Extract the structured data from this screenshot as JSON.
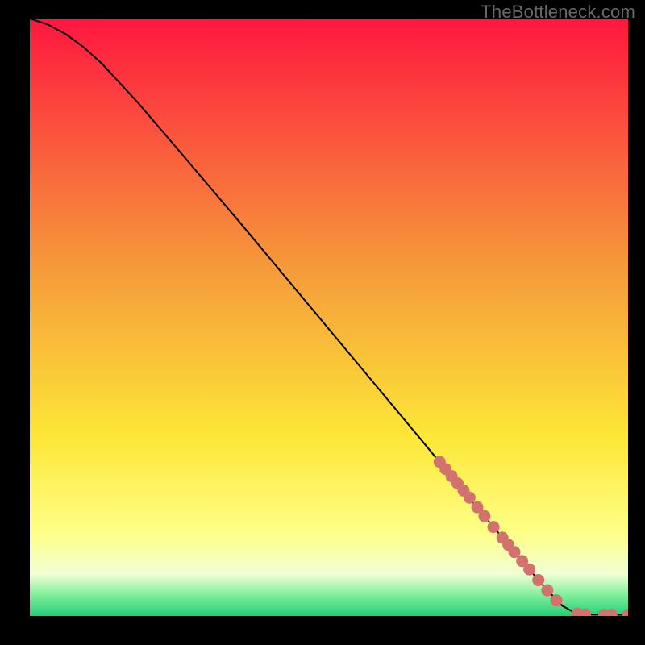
{
  "watermark": "TheBottleneck.com",
  "colors": {
    "background": "#000000",
    "curve": "#000000",
    "marker": "#d1726e",
    "gradient_top": "#ff173f",
    "gradient_mid1": "#f59b3a",
    "gradient_mid2": "#fde737",
    "gradient_mid3": "#feff87",
    "gradient_mid4": "#f1ffd5",
    "gradient_mid5": "#7df09a",
    "gradient_bottom": "#27cd78"
  },
  "chart_data": {
    "type": "line",
    "title": "",
    "xlabel": "",
    "ylabel": "",
    "xlim": [
      0,
      100
    ],
    "ylim": [
      0,
      100
    ],
    "curve": [
      {
        "x": 0,
        "y": 100.0
      },
      {
        "x": 3,
        "y": 99.0
      },
      {
        "x": 6,
        "y": 97.4
      },
      {
        "x": 9,
        "y": 95.2
      },
      {
        "x": 12,
        "y": 92.5
      },
      {
        "x": 18,
        "y": 86.0
      },
      {
        "x": 25,
        "y": 77.8
      },
      {
        "x": 35,
        "y": 66.0
      },
      {
        "x": 45,
        "y": 54.0
      },
      {
        "x": 55,
        "y": 42.0
      },
      {
        "x": 65,
        "y": 30.0
      },
      {
        "x": 72,
        "y": 21.5
      },
      {
        "x": 78,
        "y": 14.3
      },
      {
        "x": 82,
        "y": 9.5
      },
      {
        "x": 86,
        "y": 4.9
      },
      {
        "x": 89,
        "y": 1.7
      },
      {
        "x": 91,
        "y": 0.6
      },
      {
        "x": 93,
        "y": 0.25
      },
      {
        "x": 96,
        "y": 0.2
      },
      {
        "x": 100,
        "y": 0.2
      }
    ],
    "markers": [
      {
        "x": 68.5,
        "y": 25.8
      },
      {
        "x": 69.5,
        "y": 24.6
      },
      {
        "x": 70.5,
        "y": 23.4
      },
      {
        "x": 71.5,
        "y": 22.2
      },
      {
        "x": 72.5,
        "y": 21.0
      },
      {
        "x": 73.5,
        "y": 19.8
      },
      {
        "x": 74.8,
        "y": 18.2
      },
      {
        "x": 76.0,
        "y": 16.7
      },
      {
        "x": 77.5,
        "y": 14.9
      },
      {
        "x": 79.0,
        "y": 13.1
      },
      {
        "x": 80.0,
        "y": 11.9
      },
      {
        "x": 81.0,
        "y": 10.7
      },
      {
        "x": 82.3,
        "y": 9.2
      },
      {
        "x": 83.5,
        "y": 7.8
      },
      {
        "x": 85.0,
        "y": 6.0
      },
      {
        "x": 86.5,
        "y": 4.3
      },
      {
        "x": 88.0,
        "y": 2.6
      },
      {
        "x": 91.5,
        "y": 0.4
      },
      {
        "x": 92.8,
        "y": 0.25
      },
      {
        "x": 96.0,
        "y": 0.2
      },
      {
        "x": 97.2,
        "y": 0.2
      },
      {
        "x": 100.0,
        "y": 0.2
      }
    ]
  }
}
